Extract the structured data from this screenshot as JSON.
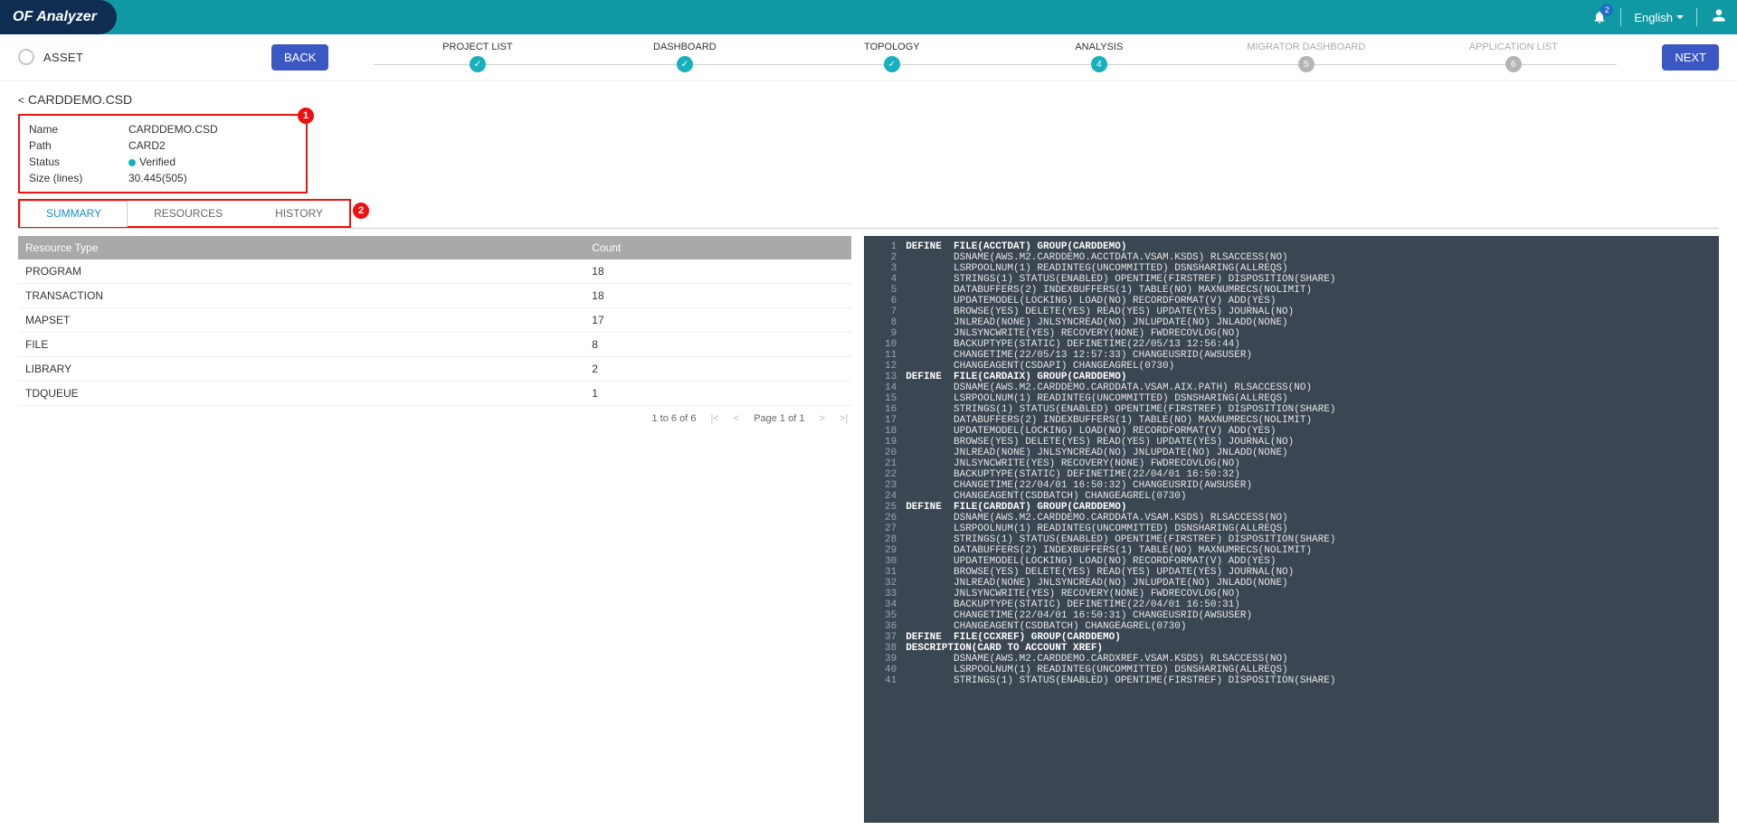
{
  "app": {
    "brand1": "OF",
    "brand2": "Analyzer",
    "lang": "English",
    "notif_count": "2"
  },
  "nav": {
    "asset": "ASSET",
    "back": "BACK",
    "next": "NEXT",
    "steps": [
      {
        "label": "PROJECT LIST",
        "state": "done",
        "num": ""
      },
      {
        "label": "DASHBOARD",
        "state": "done",
        "num": ""
      },
      {
        "label": "TOPOLOGY",
        "state": "done",
        "num": ""
      },
      {
        "label": "ANALYSIS",
        "state": "current",
        "num": "4"
      },
      {
        "label": "MIGRATOR DASHBOARD",
        "state": "future",
        "num": "5"
      },
      {
        "label": "APPLICATION LIST",
        "state": "future",
        "num": "6"
      }
    ]
  },
  "crumb": {
    "back": "<",
    "title": "CARDDEMO.CSD"
  },
  "detail": {
    "rows": [
      {
        "k": "Name",
        "v": "CARDDEMO.CSD"
      },
      {
        "k": "Path",
        "v": "CARD2"
      },
      {
        "k": "Status",
        "v": "Verified",
        "dot": true
      },
      {
        "k": "Size (lines)",
        "v": "30.445(505)"
      }
    ]
  },
  "callouts": {
    "one": "1",
    "two": "2"
  },
  "tabs": [
    {
      "label": "SUMMARY",
      "active": true
    },
    {
      "label": "RESOURCES",
      "active": false
    },
    {
      "label": "HISTORY",
      "active": false
    }
  ],
  "table": {
    "headers": [
      "Resource Type",
      "Count"
    ],
    "rows": [
      {
        "type": "PROGRAM",
        "count": "18",
        "link": false
      },
      {
        "type": "TRANSACTION",
        "count": "18",
        "link": false
      },
      {
        "type": "MAPSET",
        "count": "17",
        "link": false
      },
      {
        "type": "FILE",
        "count": "8",
        "link": true
      },
      {
        "type": "LIBRARY",
        "count": "2",
        "link": true
      },
      {
        "type": "TDQUEUE",
        "count": "1",
        "link": false
      }
    ],
    "pager": {
      "range": "1 to 6 of 6",
      "page": "Page 1 of 1"
    }
  },
  "code": [
    "DEFINE  FILE(ACCTDAT) GROUP(CARDDEMO)",
    "        DSNAME(AWS.M2.CARDDEMO.ACCTDATA.VSAM.KSDS) RLSACCESS(NO)",
    "        LSRPOOLNUM(1) READINTEG(UNCOMMITTED) DSNSHARING(ALLREQS)",
    "        STRINGS(1) STATUS(ENABLED) OPENTIME(FIRSTREF) DISPOSITION(SHARE)",
    "        DATABUFFERS(2) INDEXBUFFERS(1) TABLE(NO) MAXNUMRECS(NOLIMIT)",
    "        UPDATEMODEL(LOCKING) LOAD(NO) RECORDFORMAT(V) ADD(YES)",
    "        BROWSE(YES) DELETE(YES) READ(YES) UPDATE(YES) JOURNAL(NO)",
    "        JNLREAD(NONE) JNLSYNCREAD(NO) JNLUPDATE(NO) JNLADD(NONE)",
    "        JNLSYNCWRITE(YES) RECOVERY(NONE) FWDRECOVLOG(NO)",
    "        BACKUPTYPE(STATIC) DEFINETIME(22/05/13 12:56:44)",
    "        CHANGETIME(22/05/13 12:57:33) CHANGEUSRID(AWSUSER)",
    "        CHANGEAGENT(CSDAPI) CHANGEAGREL(0730)",
    "DEFINE  FILE(CARDAIX) GROUP(CARDDEMO)",
    "        DSNAME(AWS.M2.CARDDEMO.CARDDATA.VSAM.AIX.PATH) RLSACCESS(NO)",
    "        LSRPOOLNUM(1) READINTEG(UNCOMMITTED) DSNSHARING(ALLREQS)",
    "        STRINGS(1) STATUS(ENABLED) OPENTIME(FIRSTREF) DISPOSITION(SHARE)",
    "        DATABUFFERS(2) INDEXBUFFERS(1) TABLE(NO) MAXNUMRECS(NOLIMIT)",
    "        UPDATEMODEL(LOCKING) LOAD(NO) RECORDFORMAT(V) ADD(YES)",
    "        BROWSE(YES) DELETE(YES) READ(YES) UPDATE(YES) JOURNAL(NO)",
    "        JNLREAD(NONE) JNLSYNCREAD(NO) JNLUPDATE(NO) JNLADD(NONE)",
    "        JNLSYNCWRITE(YES) RECOVERY(NONE) FWDRECOVLOG(NO)",
    "        BACKUPTYPE(STATIC) DEFINETIME(22/04/01 16:50:32)",
    "        CHANGETIME(22/04/01 16:50:32) CHANGEUSRID(AWSUSER)",
    "        CHANGEAGENT(CSDBATCH) CHANGEAGREL(0730)",
    "DEFINE  FILE(CARDDAT) GROUP(CARDDEMO)",
    "        DSNAME(AWS.M2.CARDDEMO.CARDDATA.VSAM.KSDS) RLSACCESS(NO)",
    "        LSRPOOLNUM(1) READINTEG(UNCOMMITTED) DSNSHARING(ALLREQS)",
    "        STRINGS(1) STATUS(ENABLED) OPENTIME(FIRSTREF) DISPOSITION(SHARE)",
    "        DATABUFFERS(2) INDEXBUFFERS(1) TABLE(NO) MAXNUMRECS(NOLIMIT)",
    "        UPDATEMODEL(LOCKING) LOAD(NO) RECORDFORMAT(V) ADD(YES)",
    "        BROWSE(YES) DELETE(YES) READ(YES) UPDATE(YES) JOURNAL(NO)",
    "        JNLREAD(NONE) JNLSYNCREAD(NO) JNLUPDATE(NO) JNLADD(NONE)",
    "        JNLSYNCWRITE(YES) RECOVERY(NONE) FWDRECOVLOG(NO)",
    "        BACKUPTYPE(STATIC) DEFINETIME(22/04/01 16:50:31)",
    "        CHANGETIME(22/04/01 16:50:31) CHANGEUSRID(AWSUSER)",
    "        CHANGEAGENT(CSDBATCH) CHANGEAGREL(0730)",
    "DEFINE  FILE(CCXREF) GROUP(CARDDEMO)",
    "DESCRIPTION(CARD TO ACCOUNT XREF)",
    "        DSNAME(AWS.M2.CARDDEMO.CARDXREF.VSAM.KSDS) RLSACCESS(NO)",
    "        LSRPOOLNUM(1) READINTEG(UNCOMMITTED) DSNSHARING(ALLREQS)",
    "        STRINGS(1) STATUS(ENABLED) OPENTIME(FIRSTREF) DISPOSITION(SHARE)"
  ]
}
